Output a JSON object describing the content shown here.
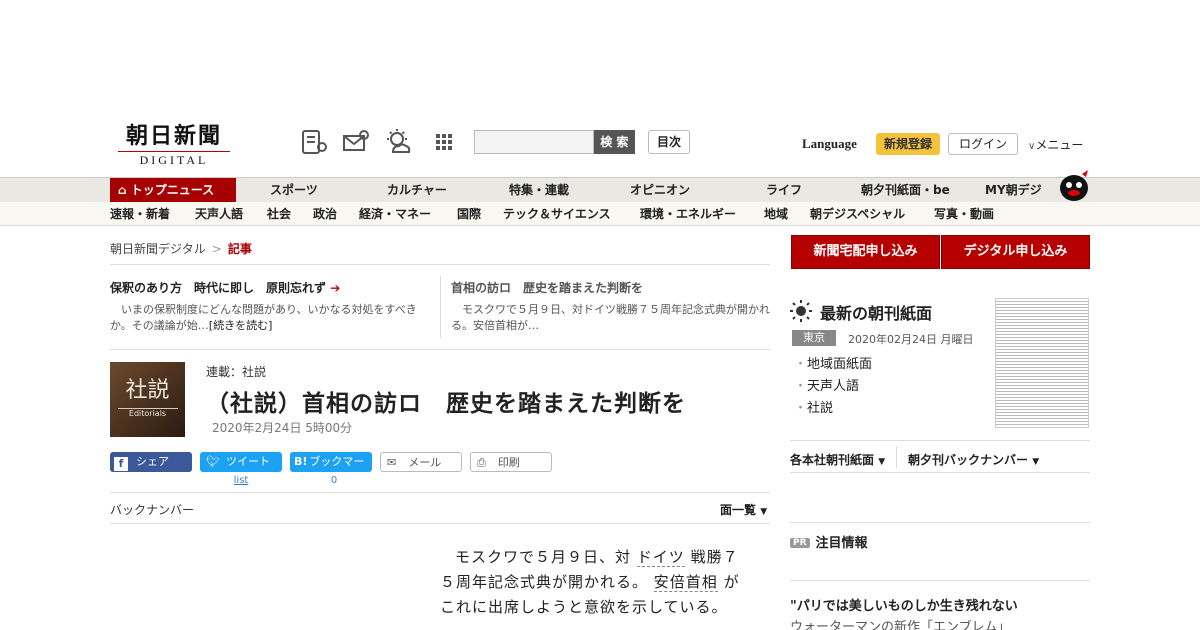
{
  "header": {
    "logo_jp": "朝日新聞",
    "logo_en": "DIGITAL",
    "search_button": "検 索",
    "mokuji": "目次",
    "language": "Language",
    "signup": "新規登録",
    "login": "ログイン",
    "menu": "メニュー",
    "icons": [
      "paper-icon",
      "mail-icon",
      "weather-icon",
      "grid-icon"
    ]
  },
  "nav_main": [
    "トップニュース",
    "スポーツ",
    "カルチャー",
    "特集・連載",
    "オピニオン",
    "ライフ",
    "朝夕刊紙面・be",
    "MY朝デジ"
  ],
  "nav_sub": [
    "速報・新着",
    "天声人語",
    "社会",
    "政治",
    "経済・マネー",
    "国際",
    "テック＆サイエンス",
    "環境・エネルギー",
    "地域",
    "朝デジスペシャル",
    "写真・動画"
  ],
  "breadcrumb": {
    "home": "朝日新聞デジタル",
    "sep": ">",
    "current": "記事"
  },
  "related": [
    {
      "title": "保釈のあり方　時代に即し　原則忘れず",
      "desc": "いまの保釈制度にどんな問題があり、いかなる対処をすべきか。その議論が始…",
      "more": "[続きを読む]"
    },
    {
      "title": "首相の訪ロ　歴史を踏まえた判断を",
      "desc": "モスクワで５月９日、対ドイツ戦勝７５周年記念式典が開かれる。安倍首相が…"
    }
  ],
  "article": {
    "badge_jp": "社説",
    "badge_en": "Editorials",
    "series": "連載：社説",
    "headline": "（社説）首相の訪ロ　歴史を踏まえた判断を",
    "date": "2020年2月24日 5時00分",
    "share": {
      "facebook": "シェア",
      "twitter": "ツイート",
      "bookmark": "ブックマーク",
      "mail": "メール",
      "print": "印刷",
      "twitter_sub": "list",
      "bookmark_sub": "0"
    },
    "backnumber": "バックナンバー",
    "page_list": "面一覧",
    "body_1": "モスクワで５月９日、対",
    "body_link_1": "ドイツ",
    "body_2": "戦勝７５周年記念式典が開かれる。",
    "body_link_2": "安倍首相",
    "body_3": "がこれに出席しようと意欲を示している。"
  },
  "sidebar": {
    "btn_paper": "新聞宅配申し込み",
    "btn_digital": "デジタル申し込み",
    "latest_title": "最新の朝刊紙面",
    "region": "東京",
    "paper_date": "2020年02月24日 月曜日",
    "list": [
      "地域面紙面",
      "天声人語",
      "社説"
    ],
    "drop_1": "各本社朝刊紙面",
    "drop_2": "朝夕刊バックナンバー",
    "pr_tag": "PR",
    "pr_title": "注目情報",
    "ad_title": "\"パリでは美しいものしか生き残れない",
    "ad_sub": "ウォーターマンの新作「エンブレム」"
  }
}
